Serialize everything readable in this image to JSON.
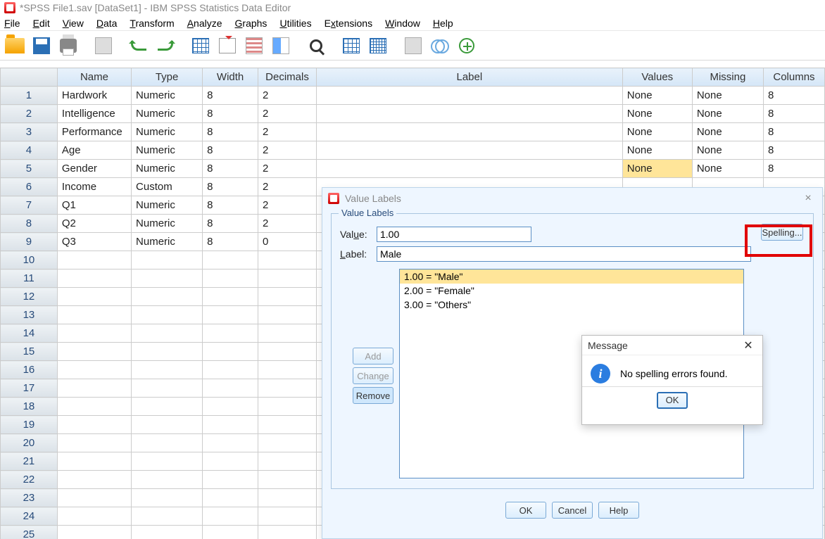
{
  "window": {
    "title": "*SPSS File1.sav [DataSet1] - IBM SPSS Statistics Data Editor"
  },
  "menu": {
    "file": "File",
    "edit": "Edit",
    "view": "View",
    "data": "Data",
    "transform": "Transform",
    "analyze": "Analyze",
    "graphs": "Graphs",
    "utilities": "Utilities",
    "extensions": "Extensions",
    "window": "Window",
    "help": "Help"
  },
  "columns": {
    "name": "Name",
    "type": "Type",
    "width": "Width",
    "decimals": "Decimals",
    "label": "Label",
    "values": "Values",
    "missing": "Missing",
    "columns": "Columns"
  },
  "rows": [
    {
      "n": "1",
      "name": "Hardwork",
      "type": "Numeric",
      "width": "8",
      "dec": "2",
      "label": "",
      "values": "None",
      "missing": "None",
      "cols": "8"
    },
    {
      "n": "2",
      "name": "Intelligence",
      "type": "Numeric",
      "width": "8",
      "dec": "2",
      "label": "",
      "values": "None",
      "missing": "None",
      "cols": "8"
    },
    {
      "n": "3",
      "name": "Performance",
      "type": "Numeric",
      "width": "8",
      "dec": "2",
      "label": "",
      "values": "None",
      "missing": "None",
      "cols": "8"
    },
    {
      "n": "4",
      "name": "Age",
      "type": "Numeric",
      "width": "8",
      "dec": "2",
      "label": "",
      "values": "None",
      "missing": "None",
      "cols": "8"
    },
    {
      "n": "5",
      "name": "Gender",
      "type": "Numeric",
      "width": "8",
      "dec": "2",
      "label": "",
      "values": "None",
      "missing": "None",
      "cols": "8",
      "hlValues": true
    },
    {
      "n": "6",
      "name": "Income",
      "type": "Custom",
      "width": "8",
      "dec": "2",
      "label": "",
      "values": "",
      "missing": "",
      "cols": ""
    },
    {
      "n": "7",
      "name": "Q1",
      "type": "Numeric",
      "width": "8",
      "dec": "2",
      "label": "",
      "values": "",
      "missing": "",
      "cols": ""
    },
    {
      "n": "8",
      "name": "Q2",
      "type": "Numeric",
      "width": "8",
      "dec": "2",
      "label": "",
      "values": "",
      "missing": "",
      "cols": ""
    },
    {
      "n": "9",
      "name": "Q3",
      "type": "Numeric",
      "width": "8",
      "dec": "0",
      "label": "",
      "values": "",
      "missing": "",
      "cols": ""
    }
  ],
  "emptyRows": [
    "10",
    "11",
    "12",
    "13",
    "14",
    "15",
    "16",
    "17",
    "18",
    "19",
    "20",
    "21",
    "22",
    "23",
    "24",
    "25"
  ],
  "valueLabels": {
    "dialogTitle": "Value Labels",
    "groupTitle": "Value Labels",
    "valueLabel": "Value:",
    "labelLabel": "Label:",
    "valueInput": "1.00",
    "labelInput": "Male",
    "items": [
      "1.00 = \"Male\"",
      "2.00 = \"Female\"",
      "3.00 = \"Others\""
    ],
    "addBtn": "Add",
    "changeBtn": "Change",
    "removeBtn": "Remove",
    "spellingBtn": "Spelling...",
    "okBtn": "OK",
    "cancelBtn": "Cancel",
    "helpBtn": "Help"
  },
  "message": {
    "title": "Message",
    "text": "No spelling errors found.",
    "ok": "OK"
  }
}
